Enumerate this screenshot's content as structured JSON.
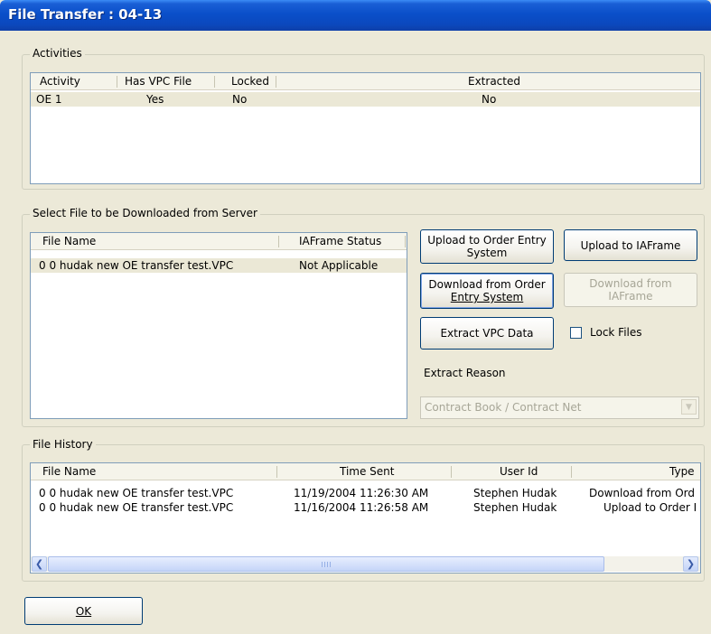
{
  "window": {
    "title": "File Transfer : 04-13"
  },
  "activities": {
    "label": "Activities",
    "columns": [
      "Activity",
      "Has VPC File",
      "Locked",
      "Extracted"
    ],
    "rows": [
      {
        "activity": "OE 1",
        "has_vpc": "Yes",
        "locked": "No",
        "extracted": "No"
      }
    ]
  },
  "select_file": {
    "label": "Select File to be Downloaded from Server",
    "columns": [
      "File Name",
      "IAFrame Status"
    ],
    "rows": [
      {
        "file_name": "0 0 hudak new OE transfer test.VPC",
        "status": "Not Applicable"
      }
    ]
  },
  "actions": {
    "upload_oe_line1": "Upload to Order Entry",
    "upload_oe_line2": "System",
    "upload_iaframe": "Upload to IAFrame",
    "download_oe_line1": "Download from Order",
    "download_oe_line2": "Entry System",
    "download_iaframe_line1": "Download from",
    "download_iaframe_line2": "IAFrame",
    "extract_vpc": "Extract VPC Data",
    "lock_files": "Lock Files",
    "lock_files_checked": false,
    "extract_reason_label": "Extract Reason",
    "extract_reason_value": "Contract Book / Contract Net"
  },
  "file_history": {
    "label": "File History",
    "columns": [
      "File Name",
      "Time Sent",
      "User Id",
      "Type"
    ],
    "rows": [
      {
        "file_name": "0 0 hudak new OE transfer test.VPC",
        "time_sent": "11/19/2004 11:26:30 AM",
        "user_id": "Stephen Hudak",
        "type": "Download from Ord"
      },
      {
        "file_name": "0 0 hudak new OE transfer test.VPC",
        "time_sent": "11/16/2004 11:26:58 AM",
        "user_id": "Stephen Hudak",
        "type": "Upload to Order I"
      }
    ]
  },
  "footer": {
    "ok": "OK"
  },
  "icons": {
    "scroll_left": "scroll-left-arrow-icon",
    "scroll_right": "scroll-right-arrow-icon",
    "dropdown": "chevron-down-icon"
  },
  "colors": {
    "titlebar": "#0a4fc9",
    "window_bg": "#ece9d8",
    "selection": "#ebe8d6"
  }
}
